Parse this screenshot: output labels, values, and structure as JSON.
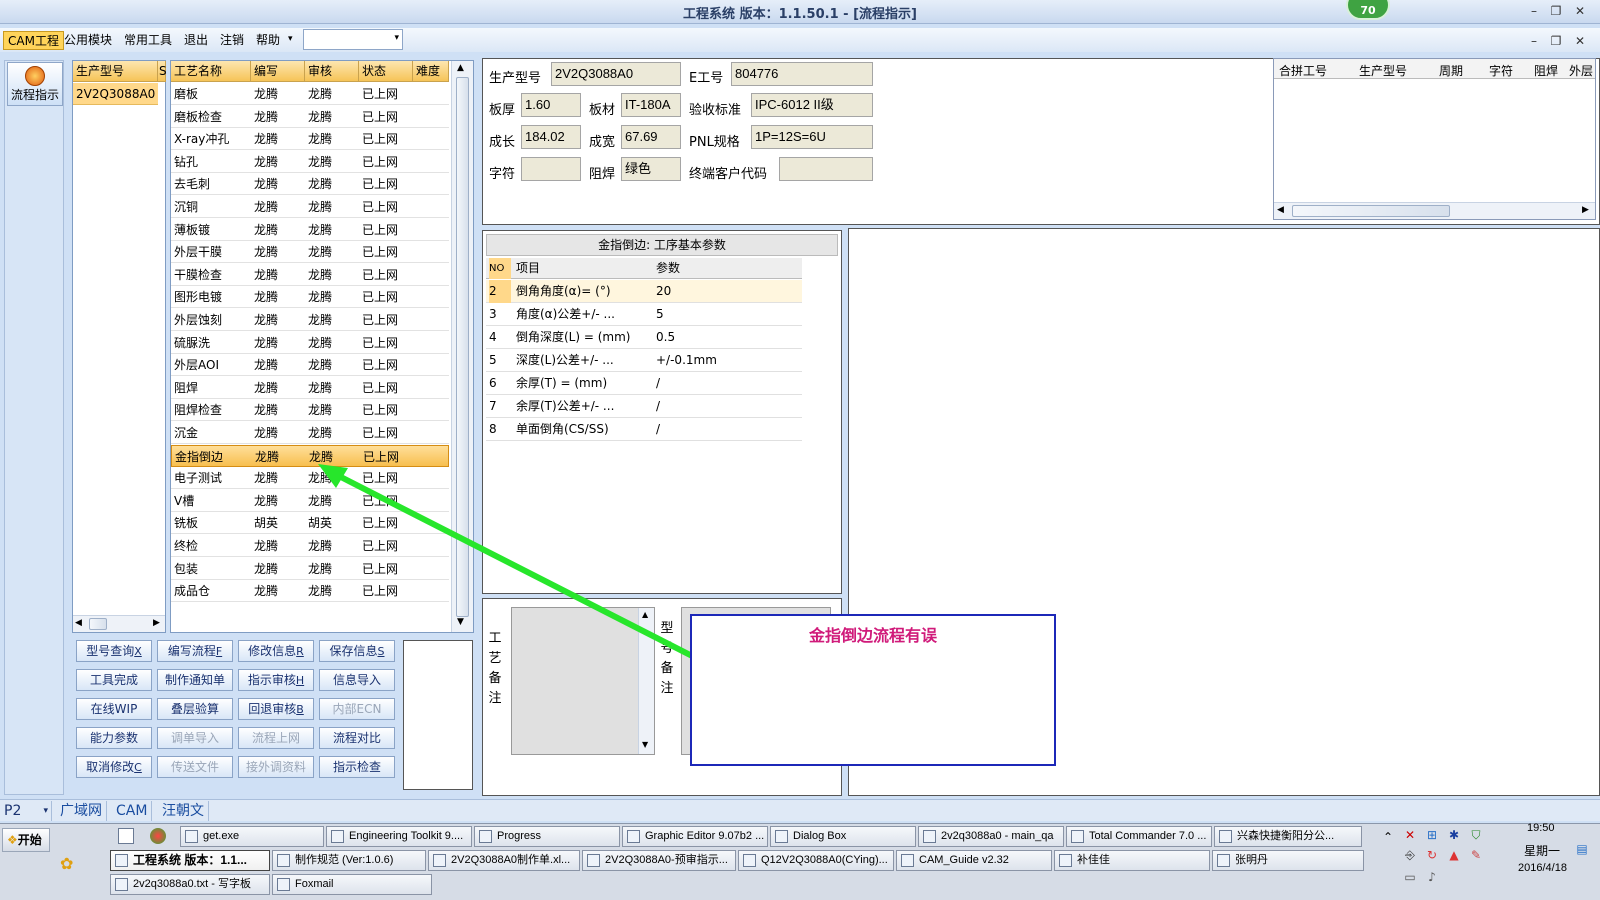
{
  "window": {
    "title": "工程系统   版本：1.1.50.1 - [流程指示]",
    "badge": "70",
    "minimize": "–",
    "restore": "❐",
    "close": "✕"
  },
  "mdi_controls": {
    "minimize": "–",
    "restore": "❐",
    "close": "✕"
  },
  "menu": {
    "items": [
      "CAM工程",
      "公用模块",
      "常用工具",
      "退出",
      "注销",
      "帮助"
    ],
    "combo_value": ""
  },
  "left_strip": {
    "flow_button": "流程指示"
  },
  "product_list": {
    "header": "生产型号",
    "header2": "S",
    "rows": [
      "2V2Q3088A0"
    ]
  },
  "process_table": {
    "headers": [
      "工艺名称",
      "编写",
      "审核",
      "状态",
      "难度"
    ],
    "rows": [
      [
        "磨板",
        "龙腾",
        "龙腾",
        "已上网"
      ],
      [
        "磨板检查",
        "龙腾",
        "龙腾",
        "已上网"
      ],
      [
        "X-ray冲孔",
        "龙腾",
        "龙腾",
        "已上网"
      ],
      [
        "钻孔",
        "龙腾",
        "龙腾",
        "已上网"
      ],
      [
        "去毛刺",
        "龙腾",
        "龙腾",
        "已上网"
      ],
      [
        "沉铜",
        "龙腾",
        "龙腾",
        "已上网"
      ],
      [
        "薄板镀",
        "龙腾",
        "龙腾",
        "已上网"
      ],
      [
        "外层干膜",
        "龙腾",
        "龙腾",
        "已上网"
      ],
      [
        "干膜检查",
        "龙腾",
        "龙腾",
        "已上网"
      ],
      [
        "图形电镀",
        "龙腾",
        "龙腾",
        "已上网"
      ],
      [
        "外层蚀刻",
        "龙腾",
        "龙腾",
        "已上网"
      ],
      [
        "硫脲洗",
        "龙腾",
        "龙腾",
        "已上网"
      ],
      [
        "外层AOI",
        "龙腾",
        "龙腾",
        "已上网"
      ],
      [
        "阻焊",
        "龙腾",
        "龙腾",
        "已上网"
      ],
      [
        "阻焊检查",
        "龙腾",
        "龙腾",
        "已上网"
      ],
      [
        "沉金",
        "龙腾",
        "龙腾",
        "已上网"
      ],
      [
        "金指倒边",
        "龙腾",
        "龙腾",
        "已上网"
      ],
      [
        "电子测试",
        "龙腾",
        "龙腾",
        "已上网"
      ],
      [
        "V槽",
        "龙腾",
        "龙腾",
        "已上网"
      ],
      [
        "铣板",
        "胡英",
        "胡英",
        "已上网"
      ],
      [
        "终检",
        "龙腾",
        "龙腾",
        "已上网"
      ],
      [
        "包装",
        "龙腾",
        "龙腾",
        "已上网"
      ],
      [
        "成品仓",
        "龙腾",
        "龙腾",
        "已上网"
      ]
    ],
    "selected_row": "金指倒边"
  },
  "buttons": [
    {
      "label": "型号查询",
      "key": "X",
      "enabled": true
    },
    {
      "label": "编写流程",
      "key": "F",
      "enabled": true
    },
    {
      "label": "修改信息",
      "key": "R",
      "enabled": true
    },
    {
      "label": "保存信息",
      "key": "S",
      "enabled": true
    },
    {
      "label": "工具完成",
      "key": "",
      "enabled": true
    },
    {
      "label": "制作通知单",
      "key": "",
      "enabled": true
    },
    {
      "label": "指示审核",
      "key": "H",
      "enabled": true
    },
    {
      "label": "信息导入",
      "key": "",
      "enabled": true
    },
    {
      "label": "在线WIP",
      "key": "",
      "enabled": true
    },
    {
      "label": "叠层验算",
      "key": "",
      "enabled": true
    },
    {
      "label": "回退审核",
      "key": "B",
      "enabled": true
    },
    {
      "label": "内部ECN",
      "key": "",
      "enabled": false
    },
    {
      "label": "能力参数",
      "key": "",
      "enabled": true
    },
    {
      "label": "调单导入",
      "key": "",
      "enabled": false
    },
    {
      "label": "流程上网",
      "key": "",
      "enabled": false
    },
    {
      "label": "流程对比",
      "key": "",
      "enabled": true
    },
    {
      "label": "取消修改",
      "key": "C",
      "enabled": true
    },
    {
      "label": "传送文件",
      "key": "",
      "enabled": false
    },
    {
      "label": "接外调资料",
      "key": "",
      "enabled": false
    },
    {
      "label": "指示检查",
      "key": "",
      "enabled": true
    }
  ],
  "info": {
    "product_model_label": "生产型号",
    "product_model": "2V2Q3088A0",
    "e_no_label": "E工号",
    "e_no": "804776",
    "thickness_label": "板厚",
    "thickness": "1.60",
    "material_label": "板材",
    "material": "IT-180A",
    "standard_label": "验收标准",
    "standard": "IPC-6012 II级",
    "length_label": "成长",
    "length": "184.02",
    "width_label": "成宽",
    "width": "67.69",
    "pnl_label": "PNL规格",
    "pnl": "1P=12S=6U",
    "char_label": "字符",
    "char": "",
    "mask_label": "阻焊",
    "mask": "绿色",
    "customer_label": "终端客户代码",
    "customer": ""
  },
  "merge_grid": {
    "headers": [
      "合拼工号",
      "生产型号",
      "周期",
      "字符",
      "阻焊",
      "外层"
    ]
  },
  "param_group": {
    "title": "金指倒边: 工序基本参数",
    "headers": [
      "NO",
      "项目",
      "参数"
    ],
    "rows": [
      [
        "2",
        "倒角角度(α)=  (°)",
        "20"
      ],
      [
        "3",
        "角度(α)公差+/- ...",
        "5"
      ],
      [
        "4",
        "倒角深度(L) =  (mm)",
        "0.5"
      ],
      [
        "5",
        "深度(L)公差+/- ...",
        "+/-0.1mm"
      ],
      [
        "6",
        "余厚(T) =  (mm)",
        "/"
      ],
      [
        "7",
        "余厚(T)公差+/-  ...",
        "/"
      ],
      [
        "8",
        "单面倒角(CS/SS)",
        "/"
      ]
    ]
  },
  "notes": {
    "process_label": "工艺备注",
    "model_label": "型号备注"
  },
  "annotation": {
    "text": "金指倒边流程有误",
    "arrow_color": "#27e62b",
    "box_color": "#1c28b8",
    "text_color": "#d01a7a"
  },
  "bottom_tabs": {
    "combo": "P2",
    "items": [
      "广域网",
      "CAM",
      "汪朝文"
    ]
  },
  "taskbar": {
    "start": "开始",
    "row1": [
      "get.exe",
      "Engineering Toolkit 9....",
      "Progress",
      "Graphic Editor 9.07b2 ...",
      "Dialog Box",
      "2v2q3088a0 - main_qa",
      "Total Commander 7.0 ...",
      "兴森快捷衡阳分公..."
    ],
    "row2": [
      "工程系统  版本：1.1...",
      "制作规范 (Ver:1.0.6)",
      "2V2Q3088A0制作单.xl...",
      "2V2Q3088A0-预审指示...",
      "Q12V2Q3088A0(CYing)...",
      "CAM_Guide v2.32",
      "补佳佳",
      "张明丹"
    ],
    "row3": [
      "2v2q3088a0.txt - 写字板",
      "Foxmail"
    ],
    "clock": {
      "time": "19:50",
      "weekday": "星期一",
      "date": "2016/4/18"
    }
  }
}
